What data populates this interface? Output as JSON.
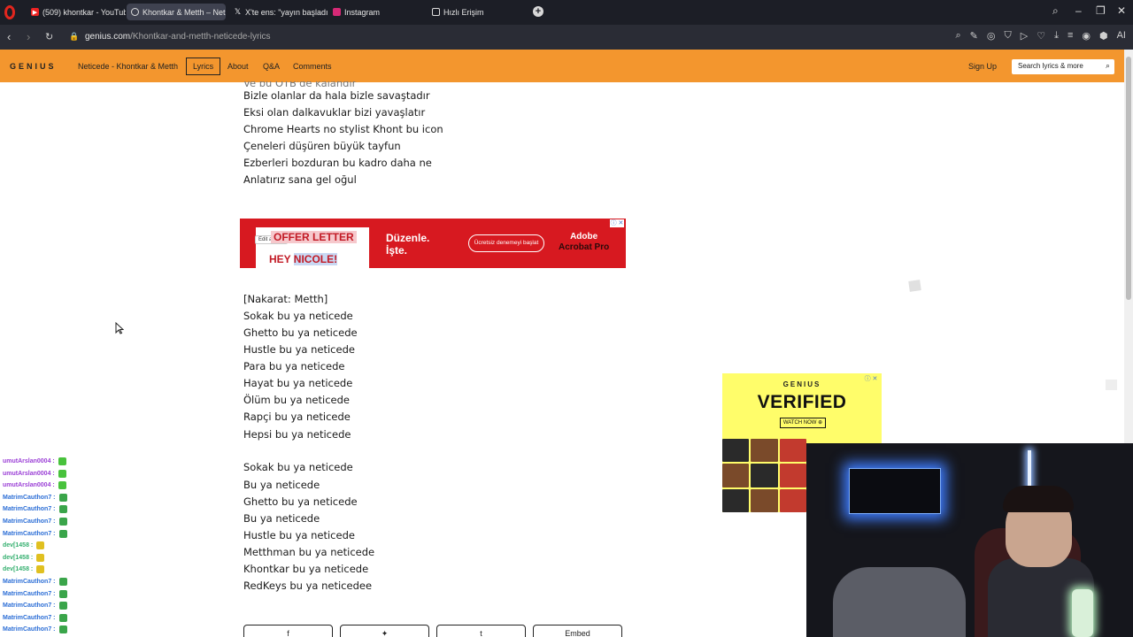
{
  "browser": {
    "tabs": [
      {
        "label": "(509) khontkar - YouTube",
        "icon": "youtube-icon"
      },
      {
        "label": "Khontkar & Metth – Neti",
        "icon": "genius-icon",
        "active": true
      },
      {
        "label": "X'te ens: \"yayın başladı htt",
        "icon": "x-icon"
      },
      {
        "label": "Instagram",
        "icon": "instagram-icon"
      },
      {
        "label": "Hızlı Erişim",
        "icon": "speed-dial-icon"
      }
    ],
    "url_host": "genius.com",
    "url_path": "/Khontkar-and-metth-neticede-lyrics",
    "ai_label": "AI"
  },
  "header": {
    "logo": "GENIUS",
    "song_link": "Neticede - Khontkar & Metth",
    "tabs": [
      "Lyrics",
      "About",
      "Q&A",
      "Comments"
    ],
    "sign_up": "Sign Up",
    "search_placeholder": "Search lyrics & more"
  },
  "lyrics": {
    "partial_top": "Ve bu OTB'de kalandır",
    "verse_end": [
      "Bizle olanlar da hala bizle savaştadır",
      "Eksi olan dalkavuklar bizi yavaşlatır",
      "Chrome Hearts no stylist Khont bu icon",
      "Çeneleri düşüren büyük tayfun",
      "Ezberleri bozduran bu kadro daha ne",
      "Anlatırız sana gel oğul"
    ],
    "chorus": [
      "[Nakarat: Metth]",
      "Sokak bu ya neticede",
      "Ghetto bu ya neticede",
      "Hustle bu ya neticede",
      "Para bu ya neticede",
      "Hayat bu ya neticede",
      "Ölüm bu ya neticede",
      "Rapçi bu ya neticede",
      "Hepsi bu ya neticede"
    ],
    "outro": [
      "Sokak bu ya neticede",
      "Bu ya neticede",
      "Ghetto bu ya neticede",
      "Bu ya neticede",
      "Hustle bu ya neticede",
      "Metthman bu ya neticede",
      "Khontkar bu ya neticede",
      "RedKeys bu ya neticedee"
    ]
  },
  "ad_adobe": {
    "edit_pdf": "Edit a PDF",
    "offer": "OFFER LETTER",
    "hey": "HEY ",
    "name": "NICOLE!",
    "headline_1": "Düzenle.",
    "headline_2": "İşte.",
    "cta": "Ücretsiz denemeyi başlat",
    "brand_1": "Adobe",
    "brand_2": "Acrobat Pro",
    "ad_icons": "ⓘ ✕"
  },
  "ad_genius": {
    "logo": "GENIUS",
    "headline": "VERIFIED",
    "cta": "WATCH NOW ⊕",
    "ad_icons": "ⓘ ✕"
  },
  "chat": [
    {
      "user": "umutArslan0004 :",
      "color": "#9b3fd6",
      "badge": "#48c23c"
    },
    {
      "user": "umutArslan0004 :",
      "color": "#9b3fd6",
      "badge": "#48c23c"
    },
    {
      "user": "umutArslan0004 :",
      "color": "#9b3fd6",
      "badge": "#48c23c"
    },
    {
      "user": "MatrimCauthon7 :",
      "color": "#2d6fd6",
      "badge": "#3aa54a"
    },
    {
      "user": "MatrimCauthon7 :",
      "color": "#2d6fd6",
      "badge": "#3aa54a"
    },
    {
      "user": "MatrimCauthon7 :",
      "color": "#2d6fd6",
      "badge": "#3aa54a"
    },
    {
      "user": "MatrimCauthon7 :",
      "color": "#2d6fd6",
      "badge": "#3aa54a"
    },
    {
      "user": "dev[1458 :",
      "color": "#36b070",
      "badge": "#e0c020"
    },
    {
      "user": "dev[1458 :",
      "color": "#36b070",
      "badge": "#e0c020"
    },
    {
      "user": "dev[1458 :",
      "color": "#36b070",
      "badge": "#e0c020"
    },
    {
      "user": "MatrimCauthon7 :",
      "color": "#2d6fd6",
      "badge": "#3aa54a"
    },
    {
      "user": "MatrimCauthon7 :",
      "color": "#2d6fd6",
      "badge": "#3aa54a"
    },
    {
      "user": "MatrimCauthon7 :",
      "color": "#2d6fd6",
      "badge": "#3aa54a"
    },
    {
      "user": "MatrimCauthon7 :",
      "color": "#2d6fd6",
      "badge": "#3aa54a"
    },
    {
      "user": "MatrimCauthon7 :",
      "color": "#2d6fd6",
      "badge": "#3aa54a"
    }
  ],
  "share": {
    "embed": "Embed"
  },
  "colors": {
    "genius_orange": "#f3962e",
    "adobe_red": "#d71920",
    "genius_yellow": "#fffd6a"
  }
}
